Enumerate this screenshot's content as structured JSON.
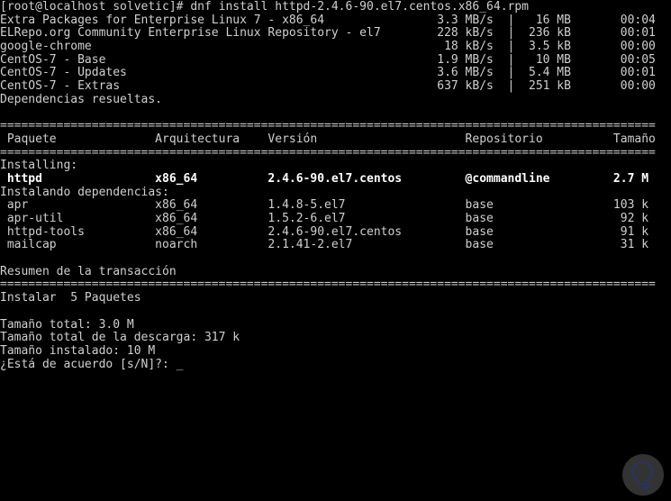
{
  "terminal": {
    "title": "CentOS terminal - dnf install httpd",
    "colors": {
      "background": "#000000",
      "foreground": "#d0d0d0",
      "bold_foreground": "#ffffff",
      "watermark_circle": "#6f6f6f",
      "watermark_bulb": "#2c3e87"
    },
    "prompt": "[root@localhost solvetic]#",
    "command": "dnf install httpd-2.4.6-90.el7.centos.x86_64.rpm",
    "command_line": "[root@localhost solvetic]# dnf install httpd-2.4.6-90.el7.centos.x86_64.rpm",
    "repo_header": "",
    "repositories": [
      {
        "name": "Extra Packages for Enterprise Linux 7 - x86_64",
        "rate": "3.3 MB/s",
        "size": "16 MB",
        "time": "00:04"
      },
      {
        "name": "ELRepo.org Community Enterprise Linux Repository - el7",
        "rate": "228 kB/s",
        "size": "236 kB",
        "time": "00:01"
      },
      {
        "name": "google-chrome",
        "rate": "18 kB/s",
        "size": "3.5 kB",
        "time": "00:00"
      },
      {
        "name": "CentOS-7 - Base",
        "rate": "1.9 MB/s",
        "size": "10 MB",
        "time": "00:05"
      },
      {
        "name": "CentOS-7 - Updates",
        "rate": "3.6 MB/s",
        "size": "5.4 MB",
        "time": "00:01"
      },
      {
        "name": "CentOS-7 - Extras",
        "rate": "637 kB/s",
        "size": "251 kB",
        "time": "00:00"
      }
    ],
    "dependencies_resolved": "Dependencias resueltas.",
    "table": {
      "separator_char": "=",
      "headers": {
        "package": "Paquete",
        "architecture": "Arquitectura",
        "version": "Versión",
        "repository": "Repositorio",
        "size": "Tamaño"
      },
      "group_installing": "Installing:",
      "group_dependencies": "Instalando dependencias:",
      "rows_installing": [
        {
          "package": "httpd",
          "arch": "x86_64",
          "version": "2.4.6-90.el7.centos",
          "repository": "@commandline",
          "size": "2.7 M",
          "bold": true
        }
      ],
      "rows_dependencies": [
        {
          "package": "apr",
          "arch": "x86_64",
          "version": "1.4.8-5.el7",
          "repository": "base",
          "size": "103 k",
          "bold": false
        },
        {
          "package": "apr-util",
          "arch": "x86_64",
          "version": "1.5.2-6.el7",
          "repository": "base",
          "size": "92 k",
          "bold": false
        },
        {
          "package": "httpd-tools",
          "arch": "x86_64",
          "version": "2.4.6-90.el7.centos",
          "repository": "base",
          "size": "91 k",
          "bold": false
        },
        {
          "package": "mailcap",
          "arch": "noarch",
          "version": "2.1.41-2.el7",
          "repository": "base",
          "size": "31 k",
          "bold": false
        }
      ]
    },
    "summary": {
      "heading": "Resumen de la transacción",
      "install_line": "Instalar  5 Paquetes",
      "total_size": "Tamaño total: 3.0 M",
      "download_size": "Tamaño total de la descarga: 317 k",
      "installed_size": "Tamaño instalado: 10 M",
      "confirm_prompt": "¿Está de acuerdo [s/N]?: ",
      "cursor": "_"
    },
    "watermark": {
      "name": "solvetic-lightbulb-logo"
    }
  }
}
